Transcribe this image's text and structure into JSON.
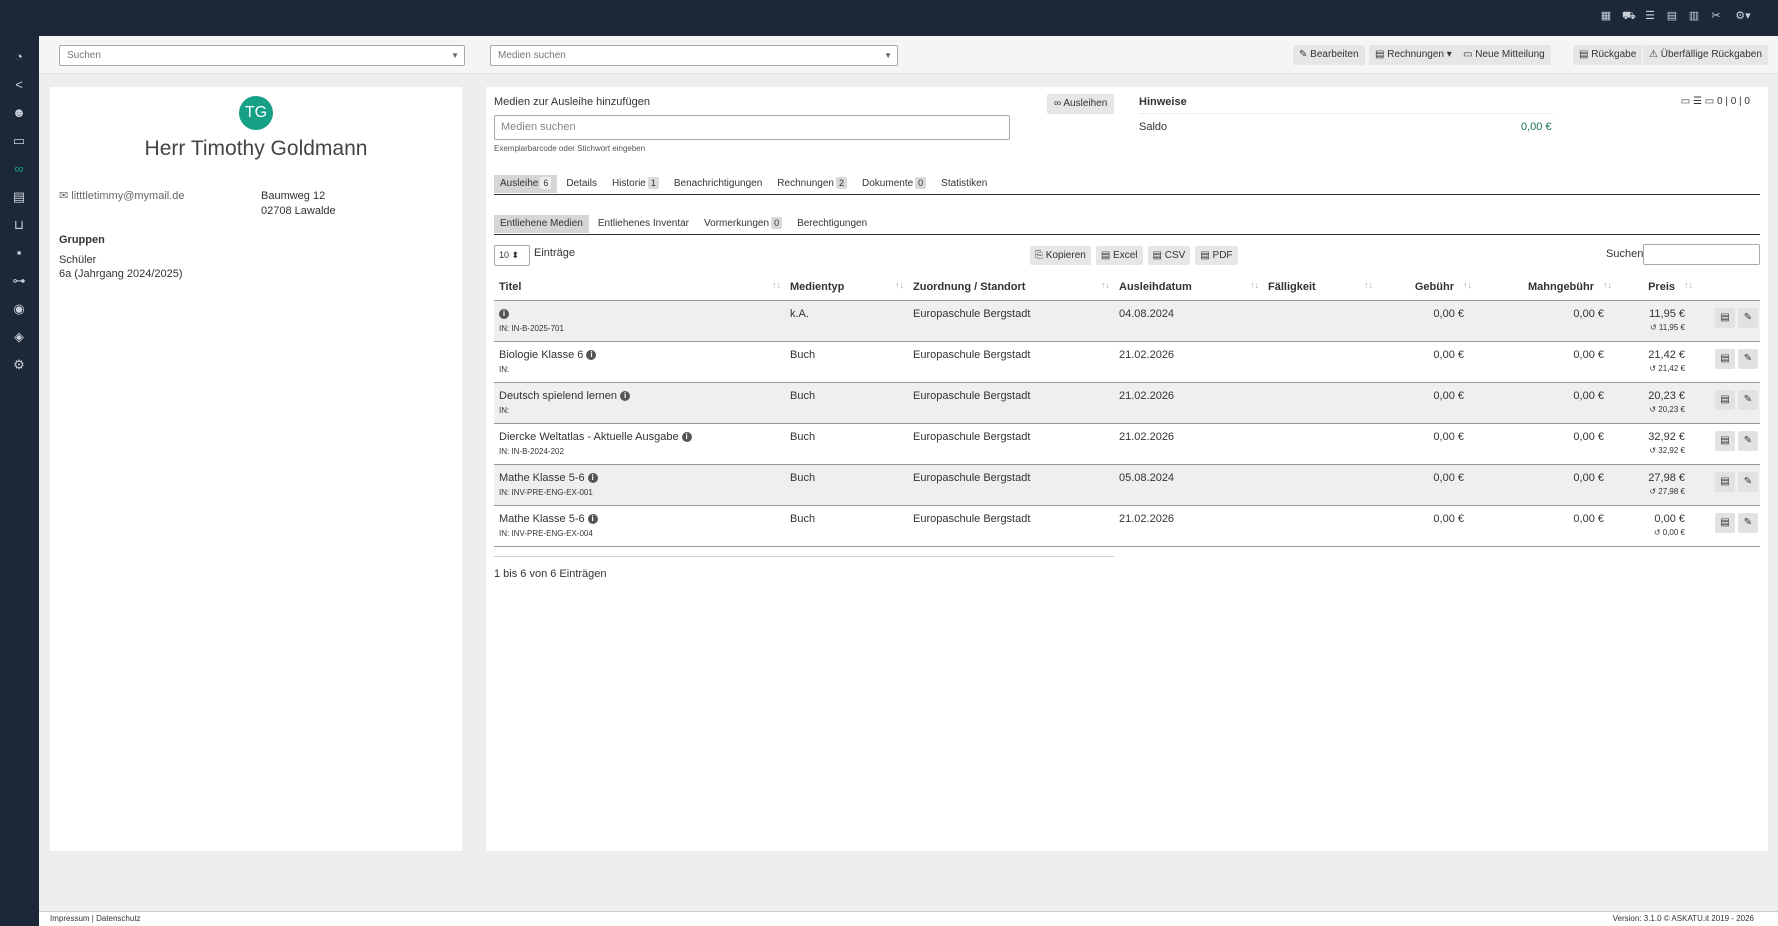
{
  "topbar_icons": [
    "calendar-icon",
    "car-icon",
    "list-icon",
    "clipboard-icon",
    "document-icon",
    "tools-icon",
    "gear-icon"
  ],
  "sidebar_icons": [
    "dashboard-icon",
    "share-icon",
    "users-icon",
    "monitor-icon",
    "handshake-icon",
    "book-icon",
    "cart-icon",
    "boxes-icon",
    "sitemap-icon",
    "person-money-icon",
    "shield-icon",
    "cogs-icon"
  ],
  "search": {
    "placeholder": "Suchen",
    "media_placeholder": "Medien suchen"
  },
  "top_buttons": {
    "bearbeiten": "Bearbeiten",
    "rechnungen": "Rechnungen",
    "neue_mitteilung": "Neue Mitteilung",
    "rueckgabe": "Rückgabe",
    "ueberfaellige": "Überfällige Rückgaben"
  },
  "user": {
    "initials": "TG",
    "name": "Herr Timothy Goldmann",
    "email": "litttletimmy@mymail.de",
    "street": "Baumweg 12",
    "city": "02708 Lawalde",
    "groups_title": "Gruppen",
    "group_1": "Schüler",
    "group_2": "6a (Jahrgang 2024/2025)"
  },
  "loan": {
    "title": "Medien zur Ausleihe hinzufügen",
    "input_placeholder": "Medien suchen",
    "help": "Exemplarbarcode oder Stichwort eingeben",
    "button": "Ausleihen"
  },
  "notes": {
    "title": "Hinweise",
    "counts": "0 | 0 | 0",
    "saldo_label": "Saldo",
    "saldo_value": "0,00 €"
  },
  "tabs": [
    {
      "label": "Ausleihe",
      "badge": "6"
    },
    {
      "label": "Details",
      "badge": ""
    },
    {
      "label": "Historie",
      "badge": "1"
    },
    {
      "label": "Benachrichtigungen",
      "badge": ""
    },
    {
      "label": "Rechnungen",
      "badge": "2"
    },
    {
      "label": "Dokumente",
      "badge": "0"
    },
    {
      "label": "Statistiken",
      "badge": ""
    }
  ],
  "subtabs": [
    {
      "label": "Entliehene Medien",
      "badge": ""
    },
    {
      "label": "Entliehenes Inventar",
      "badge": ""
    },
    {
      "label": "Vormerkungen",
      "badge": "0"
    },
    {
      "label": "Berechtigungen",
      "badge": ""
    }
  ],
  "table_controls": {
    "length": "10",
    "length_label": "Einträge",
    "search_label": "Suchen",
    "export": [
      "Kopieren",
      "Excel",
      "CSV",
      "PDF"
    ]
  },
  "columns": [
    "Titel",
    "Medientyp",
    "Zuordnung / Standort",
    "Ausleihdatum",
    "Fälligkeit",
    "Gebühr",
    "Mahngebühr",
    "Preis"
  ],
  "rows": [
    {
      "title": "",
      "in": "IN: IN-B-2025-701",
      "type": "k.A.",
      "location": "Europaschule Bergstadt",
      "date": "04.08.2024",
      "due": "",
      "fee": "0,00 €",
      "dunning": "0,00 €",
      "price": "11,95 €",
      "price_sub": "11,95 €"
    },
    {
      "title": "Biologie Klasse 6",
      "in": "IN:",
      "type": "Buch",
      "location": "Europaschule Bergstadt",
      "date": "21.02.2026",
      "due": "",
      "fee": "0,00 €",
      "dunning": "0,00 €",
      "price": "21,42 €",
      "price_sub": "21,42 €"
    },
    {
      "title": "Deutsch spielend lernen",
      "in": "IN:",
      "type": "Buch",
      "location": "Europaschule Bergstadt",
      "date": "21.02.2026",
      "due": "",
      "fee": "0,00 €",
      "dunning": "0,00 €",
      "price": "20,23 €",
      "price_sub": "20,23 €"
    },
    {
      "title": "Diercke Weltatlas - Aktuelle Ausgabe",
      "in": "IN: IN-B-2024-202",
      "type": "Buch",
      "location": "Europaschule Bergstadt",
      "date": "21.02.2026",
      "due": "",
      "fee": "0,00 €",
      "dunning": "0,00 €",
      "price": "32,92 €",
      "price_sub": "32,92 €"
    },
    {
      "title": "Mathe Klasse 5-6",
      "in": "IN: INV-PRE-ENG-EX-001",
      "type": "Buch",
      "location": "Europaschule Bergstadt",
      "date": "05.08.2024",
      "due": "",
      "fee": "0,00 €",
      "dunning": "0,00 €",
      "price": "27,98 €",
      "price_sub": "27,98 €"
    },
    {
      "title": "Mathe Klasse 5-6",
      "in": "IN: INV-PRE-ENG-EX-004",
      "type": "Buch",
      "location": "Europaschule Bergstadt",
      "date": "21.02.2026",
      "due": "",
      "fee": "0,00 €",
      "dunning": "0,00 €",
      "price": "0,00 €",
      "price_sub": "0,00 €"
    }
  ],
  "table_info": "1 bis 6 von 6 Einträgen",
  "footer": {
    "links": "Impressum | Datenschutz",
    "version": "Version: 3.1.0   © ASKATU.it 2019 - 2026"
  },
  "colors": {
    "nav_bg": "#1c2738",
    "accent": "#16a085"
  }
}
